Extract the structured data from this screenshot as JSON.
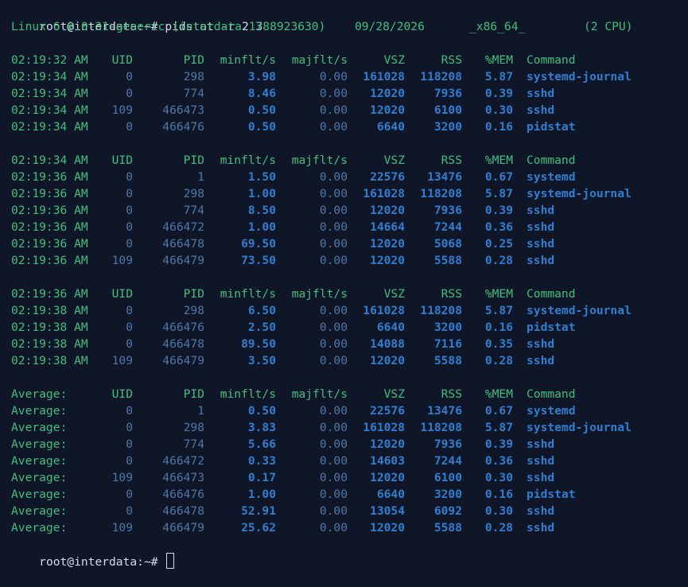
{
  "prompt": "root@interdata:~# ",
  "command": "pidstat -r 2 3",
  "sysinfo": {
    "kernel": "Linux 6.8.0-31-generic (interdata.1788923630)",
    "date": "09/28/2026",
    "arch": "_x86_64_",
    "cpus": "(2 CPU)"
  },
  "header": {
    "uid": "UID",
    "pid": "PID",
    "minflt": "minflt/s",
    "majflt": "majflt/s",
    "vsz": "VSZ",
    "rss": "RSS",
    "mem": "%MEM",
    "cmd": "Command"
  },
  "blocks": [
    {
      "header_time": "02:19:32 AM",
      "rows": [
        {
          "time": "02:19:34 AM",
          "uid": "0",
          "pid": "298",
          "minflt": "3.98",
          "majflt": "0.00",
          "vsz": "161028",
          "rss": "118208",
          "mem": "5.87",
          "cmd": "systemd-journal"
        },
        {
          "time": "02:19:34 AM",
          "uid": "0",
          "pid": "774",
          "minflt": "8.46",
          "majflt": "0.00",
          "vsz": "12020",
          "rss": "7936",
          "mem": "0.39",
          "cmd": "sshd"
        },
        {
          "time": "02:19:34 AM",
          "uid": "109",
          "pid": "466473",
          "minflt": "0.50",
          "majflt": "0.00",
          "vsz": "12020",
          "rss": "6100",
          "mem": "0.30",
          "cmd": "sshd"
        },
        {
          "time": "02:19:34 AM",
          "uid": "0",
          "pid": "466476",
          "minflt": "0.50",
          "majflt": "0.00",
          "vsz": "6640",
          "rss": "3200",
          "mem": "0.16",
          "cmd": "pidstat"
        }
      ]
    },
    {
      "header_time": "02:19:34 AM",
      "rows": [
        {
          "time": "02:19:36 AM",
          "uid": "0",
          "pid": "1",
          "minflt": "1.50",
          "majflt": "0.00",
          "vsz": "22576",
          "rss": "13476",
          "mem": "0.67",
          "cmd": "systemd"
        },
        {
          "time": "02:19:36 AM",
          "uid": "0",
          "pid": "298",
          "minflt": "1.00",
          "majflt": "0.00",
          "vsz": "161028",
          "rss": "118208",
          "mem": "5.87",
          "cmd": "systemd-journal"
        },
        {
          "time": "02:19:36 AM",
          "uid": "0",
          "pid": "774",
          "minflt": "8.50",
          "majflt": "0.00",
          "vsz": "12020",
          "rss": "7936",
          "mem": "0.39",
          "cmd": "sshd"
        },
        {
          "time": "02:19:36 AM",
          "uid": "0",
          "pid": "466472",
          "minflt": "1.00",
          "majflt": "0.00",
          "vsz": "14664",
          "rss": "7244",
          "mem": "0.36",
          "cmd": "sshd"
        },
        {
          "time": "02:19:36 AM",
          "uid": "0",
          "pid": "466478",
          "minflt": "69.50",
          "majflt": "0.00",
          "vsz": "12020",
          "rss": "5068",
          "mem": "0.25",
          "cmd": "sshd"
        },
        {
          "time": "02:19:36 AM",
          "uid": "109",
          "pid": "466479",
          "minflt": "73.50",
          "majflt": "0.00",
          "vsz": "12020",
          "rss": "5588",
          "mem": "0.28",
          "cmd": "sshd"
        }
      ]
    },
    {
      "header_time": "02:19:36 AM",
      "rows": [
        {
          "time": "02:19:38 AM",
          "uid": "0",
          "pid": "298",
          "minflt": "6.50",
          "majflt": "0.00",
          "vsz": "161028",
          "rss": "118208",
          "mem": "5.87",
          "cmd": "systemd-journal"
        },
        {
          "time": "02:19:38 AM",
          "uid": "0",
          "pid": "466476",
          "minflt": "2.50",
          "majflt": "0.00",
          "vsz": "6640",
          "rss": "3200",
          "mem": "0.16",
          "cmd": "pidstat"
        },
        {
          "time": "02:19:38 AM",
          "uid": "0",
          "pid": "466478",
          "minflt": "89.50",
          "majflt": "0.00",
          "vsz": "14088",
          "rss": "7116",
          "mem": "0.35",
          "cmd": "sshd"
        },
        {
          "time": "02:19:38 AM",
          "uid": "109",
          "pid": "466479",
          "minflt": "3.50",
          "majflt": "0.00",
          "vsz": "12020",
          "rss": "5588",
          "mem": "0.28",
          "cmd": "sshd"
        }
      ]
    },
    {
      "header_time": "Average:",
      "rows": [
        {
          "time": "Average:",
          "uid": "0",
          "pid": "1",
          "minflt": "0.50",
          "majflt": "0.00",
          "vsz": "22576",
          "rss": "13476",
          "mem": "0.67",
          "cmd": "systemd"
        },
        {
          "time": "Average:",
          "uid": "0",
          "pid": "298",
          "minflt": "3.83",
          "majflt": "0.00",
          "vsz": "161028",
          "rss": "118208",
          "mem": "5.87",
          "cmd": "systemd-journal"
        },
        {
          "time": "Average:",
          "uid": "0",
          "pid": "774",
          "minflt": "5.66",
          "majflt": "0.00",
          "vsz": "12020",
          "rss": "7936",
          "mem": "0.39",
          "cmd": "sshd"
        },
        {
          "time": "Average:",
          "uid": "0",
          "pid": "466472",
          "minflt": "0.33",
          "majflt": "0.00",
          "vsz": "14603",
          "rss": "7244",
          "mem": "0.36",
          "cmd": "sshd"
        },
        {
          "time": "Average:",
          "uid": "109",
          "pid": "466473",
          "minflt": "0.17",
          "majflt": "0.00",
          "vsz": "12020",
          "rss": "6100",
          "mem": "0.30",
          "cmd": "sshd"
        },
        {
          "time": "Average:",
          "uid": "0",
          "pid": "466476",
          "minflt": "1.00",
          "majflt": "0.00",
          "vsz": "6640",
          "rss": "3200",
          "mem": "0.16",
          "cmd": "pidstat"
        },
        {
          "time": "Average:",
          "uid": "0",
          "pid": "466478",
          "minflt": "52.91",
          "majflt": "0.00",
          "vsz": "13054",
          "rss": "6092",
          "mem": "0.30",
          "cmd": "sshd"
        },
        {
          "time": "Average:",
          "uid": "109",
          "pid": "466479",
          "minflt": "25.62",
          "majflt": "0.00",
          "vsz": "12020",
          "rss": "5588",
          "mem": "0.28",
          "cmd": "sshd"
        }
      ]
    }
  ]
}
